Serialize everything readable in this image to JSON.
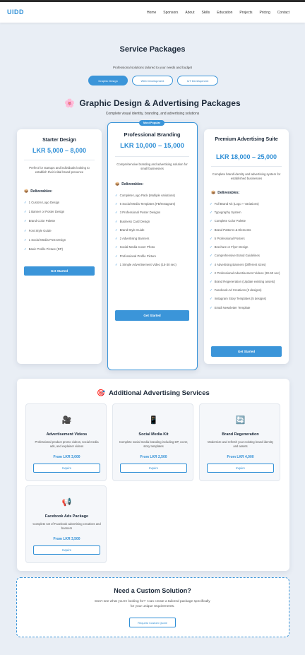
{
  "header": {
    "logo": "UIDD",
    "nav": [
      "Home",
      "Sponsors",
      "About",
      "Skills",
      "Education",
      "Projects",
      "Pricing",
      "Contact"
    ]
  },
  "hero": {
    "title": "Service Packages",
    "subtitle": "Professional solutions tailored to your needs and budget",
    "tabs": [
      {
        "label": "Graphic Design",
        "active": true
      },
      {
        "label": "Web Development",
        "active": false
      },
      {
        "label": "IoT Development",
        "active": false
      }
    ]
  },
  "section": {
    "icon": "palette-icon",
    "title": "Graphic Design & Advertising Packages",
    "subtitle": "Complete visual identity, branding, and advertising solutions"
  },
  "packages": [
    {
      "title": "Starter Design",
      "price": "LKR 5,000 – 8,000",
      "desc": "Perfect for startups and individuals looking to establish their initial brand presence",
      "deliverables_label": "Deliverables:",
      "items": [
        "1 Custom Logo Design",
        "1 Banner or Poster Design",
        "Brand Color Palette",
        "Font Style Guide",
        "1 Social Media Post Design",
        "Basic Profile Picture (DP)"
      ],
      "button": "Get Started"
    },
    {
      "badge": "Most Popular",
      "title": "Professional Branding",
      "price": "LKR 10,000 – 15,000",
      "desc": "Comprehensive branding and advertising solution for small businesses",
      "deliverables_label": "Deliverables:",
      "items": [
        "Complete Logo Pack (Multiple variations)",
        "5 Social Media Templates (FB/Instagram)",
        "3 Professional Poster Designs",
        "Business Card Design",
        "Brand Style Guide",
        "2 Advertising Banners",
        "Social Media Cover Photo",
        "Professional Profile Picture",
        "1 Simple Advertisement Video (15-30 sec)"
      ],
      "button": "Get Started"
    },
    {
      "title": "Premium Advertising Suite",
      "price": "LKR 18,000 – 25,000",
      "desc": "Complete brand identity and advertising system for established businesses",
      "deliverables_label": "Deliverables:",
      "items": [
        "Full Brand Kit (Logo + Variations)",
        "Typography System",
        "Complete Color Palette",
        "Brand Patterns & Elements",
        "5 Professional Posters",
        "Brochure or Flyer Design",
        "Comprehensive Brand Guidelines",
        "4 Advertising Banners (Different sizes)",
        "2 Professional Advertisement Videos (30-60 sec)",
        "Brand Regeneration (Update existing assets)",
        "Facebook Ad Creatives (3 designs)",
        "Instagram Story Templates (5 designs)",
        "Email Newsletter Template"
      ],
      "button": "Get Started"
    }
  ],
  "additional": {
    "icon": "target-icon",
    "title": "Additional Advertising Services",
    "services": [
      {
        "icon": "video-camera-icon",
        "glyph": "🎥",
        "title": "Advertisement Videos",
        "desc": "Professional product promo videos, social media ads, and explainer videos",
        "price": "From LKR 3,000",
        "button": "Inquire"
      },
      {
        "icon": "mobile-phone-icon",
        "glyph": "📱",
        "title": "Social Media Kit",
        "desc": "Complete social media branding including DP, cover, story templates",
        "price": "From LKR 2,500",
        "button": "Inquire"
      },
      {
        "icon": "refresh-icon",
        "glyph": "🔄",
        "title": "Brand Regeneration",
        "desc": "Modernize and refresh your existing brand identity and assets",
        "price": "From LKR 4,000",
        "button": "Inquire"
      },
      {
        "icon": "megaphone-icon",
        "glyph": "📢",
        "title": "Facebook Ads Package",
        "desc": "Complete set of Facebook advertising creatives and banners",
        "price": "From LKR 3,500",
        "button": "Inquire"
      }
    ]
  },
  "custom": {
    "title": "Need a Custom Solution?",
    "desc": "Don't see what you're looking for? I can create a tailored package specifically for your unique requirements.",
    "button": "Request Custom Quote"
  }
}
